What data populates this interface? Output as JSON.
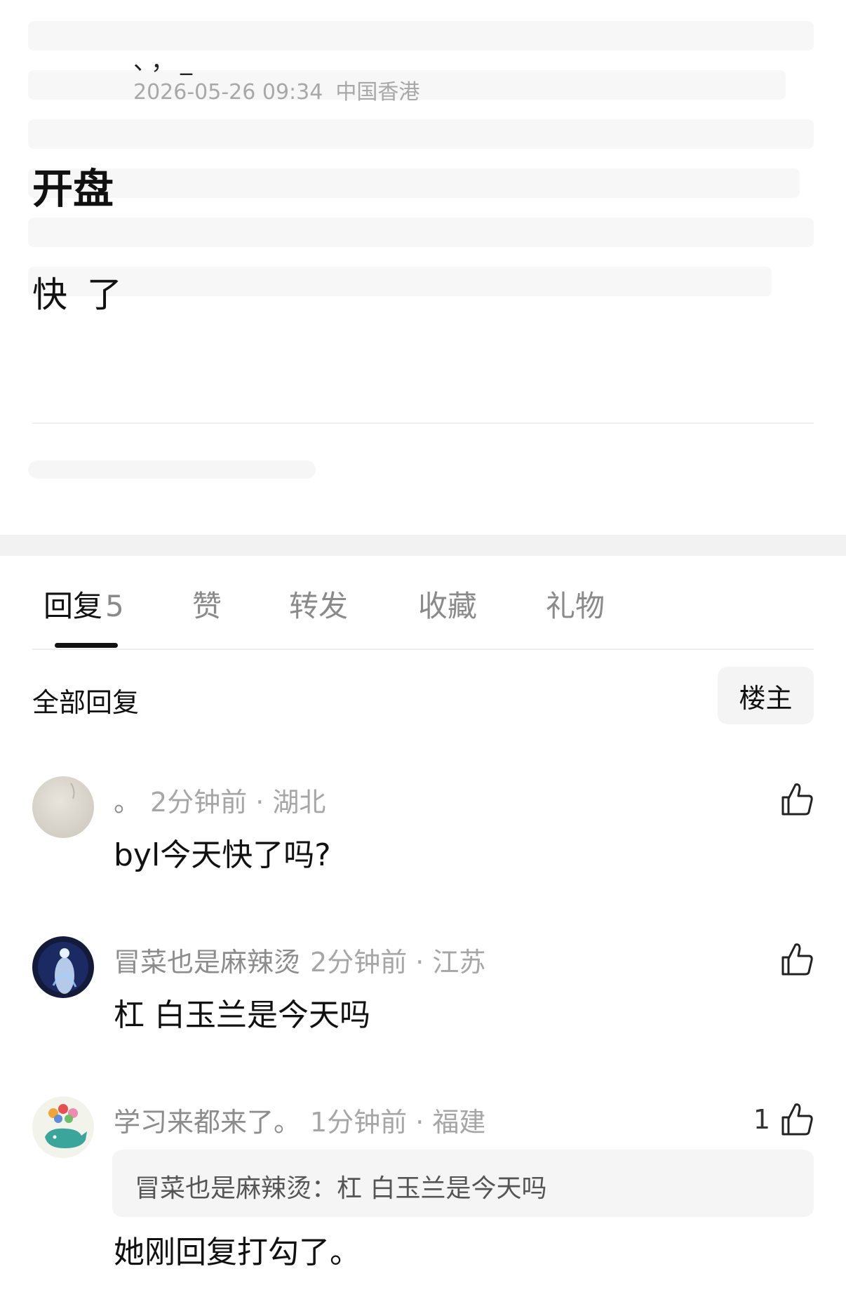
{
  "post": {
    "author": "、，_",
    "time": "2026-05-26 09:34",
    "location": "中国香港",
    "title": "开盘",
    "body": "快 了"
  },
  "tabs": [
    {
      "label": "回复",
      "count": "5"
    },
    {
      "label": "赞"
    },
    {
      "label": "转发"
    },
    {
      "label": "收藏"
    },
    {
      "label": "礼物"
    }
  ],
  "filter": {
    "title": "全部回复",
    "op_label": "楼主"
  },
  "comments": [
    {
      "name": "。",
      "meta": "2分钟前 · 湖北",
      "text": "byl今天快了吗?",
      "likes": "",
      "avatar": "paper-texture-avatar"
    },
    {
      "name": "冒菜也是麻辣烫",
      "meta": "2分钟前 · 江苏",
      "text": "杠 白玉兰是今天吗",
      "likes": "",
      "avatar": "glowing-figure-avatar"
    },
    {
      "name": "学习来都来了。",
      "meta": "1分钟前 · 福建",
      "quote": "冒菜也是麻辣烫：杠 白玉兰是今天吗",
      "text": "她刚回复打勾了。",
      "likes": "1",
      "avatar": "whale-cartoon-avatar"
    }
  ],
  "colors": {
    "accent": "#111111",
    "muted": "#8c8c8c",
    "section_bg": "#f2f2f2"
  }
}
